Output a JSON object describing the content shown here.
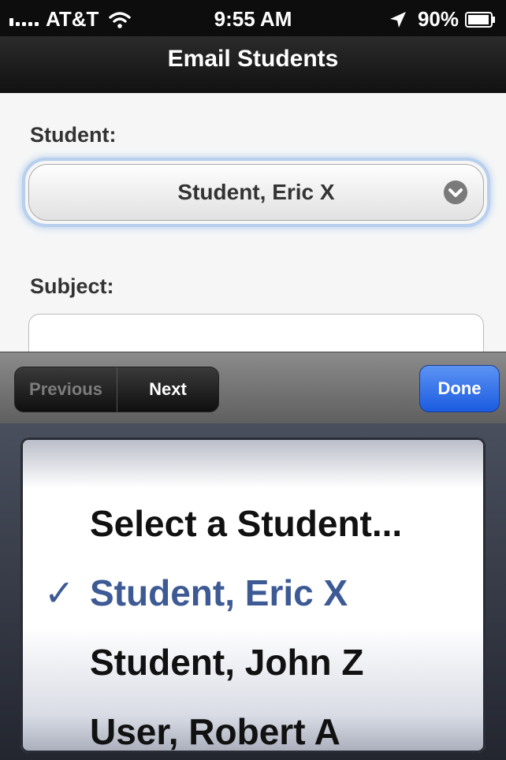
{
  "status_bar": {
    "carrier": "AT&T",
    "time": "9:55 AM",
    "battery": "90%",
    "icons": [
      "signal-icon",
      "wifi-icon",
      "location-icon",
      "battery-icon"
    ]
  },
  "nav": {
    "title": "Email Students"
  },
  "form": {
    "student_label": "Student:",
    "student_value": "Student, Eric X",
    "subject_label": "Subject:",
    "subject_value": ""
  },
  "toolbar": {
    "previous_label": "Previous",
    "next_label": "Next",
    "done_label": "Done",
    "done_color": "#2a6cf0"
  },
  "picker": {
    "items": [
      {
        "label": "Select a Student...",
        "selected": false
      },
      {
        "label": "Student, Eric X",
        "selected": true
      },
      {
        "label": "Student, John Z",
        "selected": false
      },
      {
        "label": "User, Robert A",
        "selected": false
      }
    ],
    "check_glyph": "✓",
    "selected_color": "#3d5a94"
  }
}
